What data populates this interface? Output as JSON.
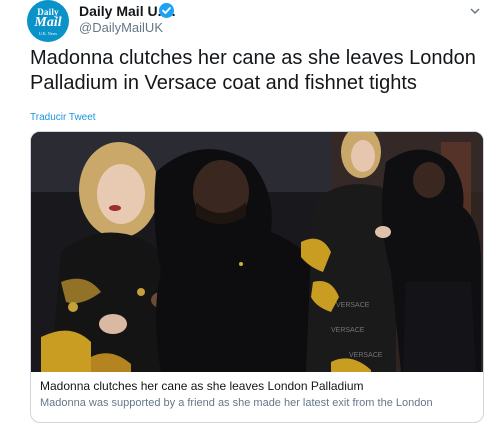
{
  "author": {
    "name": "Daily Mail U.K.",
    "handle": "@DailyMailUK",
    "avatar_line1": "Daily",
    "avatar_line2": "Mail",
    "avatar_line3": "U.K. News"
  },
  "tweet": {
    "text": "Madonna clutches her cane as she leaves London Palladium in Versace coat and fishnet tights",
    "translate_label": "Traducir Tweet"
  },
  "card": {
    "title": "Madonna clutches her cane as she leaves London Palladium",
    "description": "Madonna was supported by a friend as she made her latest exit from the London"
  },
  "colors": {
    "link": "#1b95e0",
    "verified": "#1da1f2",
    "avatar": "#0a93c9"
  },
  "icons": [
    "verified-badge-icon",
    "caret-down-icon"
  ]
}
